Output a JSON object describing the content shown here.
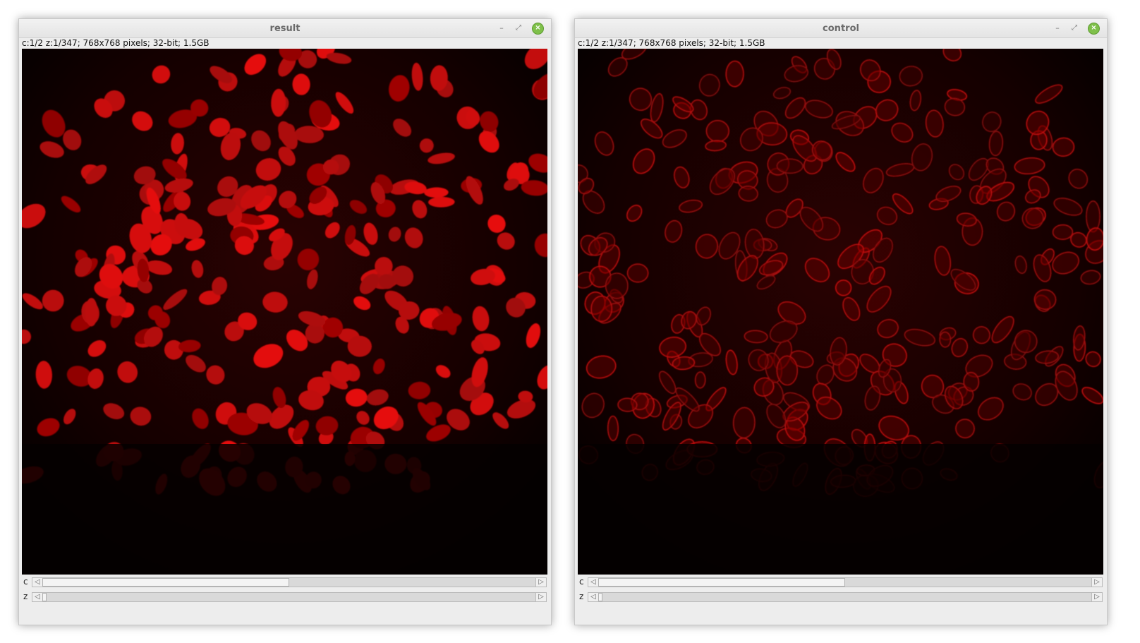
{
  "windows": [
    {
      "title": "result",
      "info": "c:1/2 z:1/347; 768x768 pixels; 32-bit; 1.5GB",
      "sliders": [
        {
          "label": "c",
          "value_fraction": 0.5
        },
        {
          "label": "z",
          "value_fraction": 0.0
        }
      ]
    },
    {
      "title": "control",
      "info": "c:1/2 z:1/347; 768x768 pixels; 32-bit; 1.5GB",
      "sliders": [
        {
          "label": "c",
          "value_fraction": 0.5
        },
        {
          "label": "z",
          "value_fraction": 0.0
        }
      ]
    }
  ],
  "window_buttons": {
    "minimize": "–",
    "maximize": "⤢",
    "close": "×"
  },
  "icons": {
    "left_arrow": "left-arrow-icon",
    "right_arrow": "right-arrow-icon"
  },
  "colors": {
    "nuclei_fill": "#cc1010",
    "nuclei_outline": "#c01010",
    "background": "#000000"
  }
}
